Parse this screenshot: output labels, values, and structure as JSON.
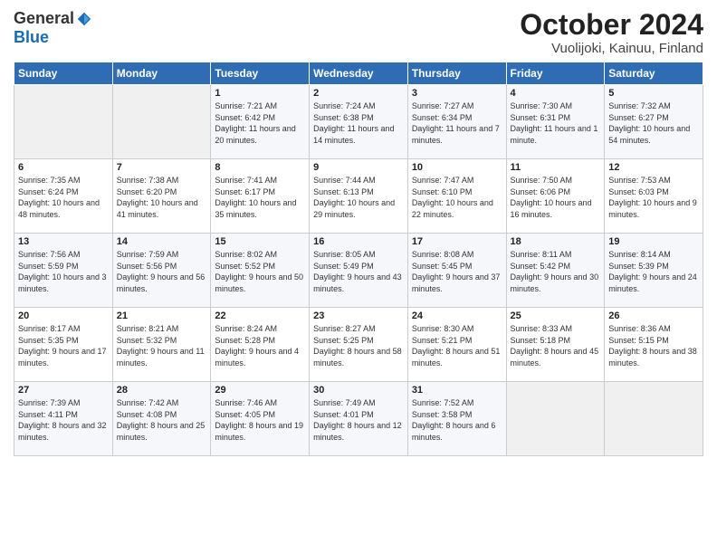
{
  "logo": {
    "general": "General",
    "blue": "Blue"
  },
  "header": {
    "month": "October 2024",
    "location": "Vuolijoki, Kainuu, Finland"
  },
  "days_of_week": [
    "Sunday",
    "Monday",
    "Tuesday",
    "Wednesday",
    "Thursday",
    "Friday",
    "Saturday"
  ],
  "weeks": [
    [
      {
        "day": "",
        "info": ""
      },
      {
        "day": "",
        "info": ""
      },
      {
        "day": "1",
        "info": "Sunrise: 7:21 AM\nSunset: 6:42 PM\nDaylight: 11 hours and 20 minutes."
      },
      {
        "day": "2",
        "info": "Sunrise: 7:24 AM\nSunset: 6:38 PM\nDaylight: 11 hours and 14 minutes."
      },
      {
        "day": "3",
        "info": "Sunrise: 7:27 AM\nSunset: 6:34 PM\nDaylight: 11 hours and 7 minutes."
      },
      {
        "day": "4",
        "info": "Sunrise: 7:30 AM\nSunset: 6:31 PM\nDaylight: 11 hours and 1 minute."
      },
      {
        "day": "5",
        "info": "Sunrise: 7:32 AM\nSunset: 6:27 PM\nDaylight: 10 hours and 54 minutes."
      }
    ],
    [
      {
        "day": "6",
        "info": "Sunrise: 7:35 AM\nSunset: 6:24 PM\nDaylight: 10 hours and 48 minutes."
      },
      {
        "day": "7",
        "info": "Sunrise: 7:38 AM\nSunset: 6:20 PM\nDaylight: 10 hours and 41 minutes."
      },
      {
        "day": "8",
        "info": "Sunrise: 7:41 AM\nSunset: 6:17 PM\nDaylight: 10 hours and 35 minutes."
      },
      {
        "day": "9",
        "info": "Sunrise: 7:44 AM\nSunset: 6:13 PM\nDaylight: 10 hours and 29 minutes."
      },
      {
        "day": "10",
        "info": "Sunrise: 7:47 AM\nSunset: 6:10 PM\nDaylight: 10 hours and 22 minutes."
      },
      {
        "day": "11",
        "info": "Sunrise: 7:50 AM\nSunset: 6:06 PM\nDaylight: 10 hours and 16 minutes."
      },
      {
        "day": "12",
        "info": "Sunrise: 7:53 AM\nSunset: 6:03 PM\nDaylight: 10 hours and 9 minutes."
      }
    ],
    [
      {
        "day": "13",
        "info": "Sunrise: 7:56 AM\nSunset: 5:59 PM\nDaylight: 10 hours and 3 minutes."
      },
      {
        "day": "14",
        "info": "Sunrise: 7:59 AM\nSunset: 5:56 PM\nDaylight: 9 hours and 56 minutes."
      },
      {
        "day": "15",
        "info": "Sunrise: 8:02 AM\nSunset: 5:52 PM\nDaylight: 9 hours and 50 minutes."
      },
      {
        "day": "16",
        "info": "Sunrise: 8:05 AM\nSunset: 5:49 PM\nDaylight: 9 hours and 43 minutes."
      },
      {
        "day": "17",
        "info": "Sunrise: 8:08 AM\nSunset: 5:45 PM\nDaylight: 9 hours and 37 minutes."
      },
      {
        "day": "18",
        "info": "Sunrise: 8:11 AM\nSunset: 5:42 PM\nDaylight: 9 hours and 30 minutes."
      },
      {
        "day": "19",
        "info": "Sunrise: 8:14 AM\nSunset: 5:39 PM\nDaylight: 9 hours and 24 minutes."
      }
    ],
    [
      {
        "day": "20",
        "info": "Sunrise: 8:17 AM\nSunset: 5:35 PM\nDaylight: 9 hours and 17 minutes."
      },
      {
        "day": "21",
        "info": "Sunrise: 8:21 AM\nSunset: 5:32 PM\nDaylight: 9 hours and 11 minutes."
      },
      {
        "day": "22",
        "info": "Sunrise: 8:24 AM\nSunset: 5:28 PM\nDaylight: 9 hours and 4 minutes."
      },
      {
        "day": "23",
        "info": "Sunrise: 8:27 AM\nSunset: 5:25 PM\nDaylight: 8 hours and 58 minutes."
      },
      {
        "day": "24",
        "info": "Sunrise: 8:30 AM\nSunset: 5:21 PM\nDaylight: 8 hours and 51 minutes."
      },
      {
        "day": "25",
        "info": "Sunrise: 8:33 AM\nSunset: 5:18 PM\nDaylight: 8 hours and 45 minutes."
      },
      {
        "day": "26",
        "info": "Sunrise: 8:36 AM\nSunset: 5:15 PM\nDaylight: 8 hours and 38 minutes."
      }
    ],
    [
      {
        "day": "27",
        "info": "Sunrise: 7:39 AM\nSunset: 4:11 PM\nDaylight: 8 hours and 32 minutes."
      },
      {
        "day": "28",
        "info": "Sunrise: 7:42 AM\nSunset: 4:08 PM\nDaylight: 8 hours and 25 minutes."
      },
      {
        "day": "29",
        "info": "Sunrise: 7:46 AM\nSunset: 4:05 PM\nDaylight: 8 hours and 19 minutes."
      },
      {
        "day": "30",
        "info": "Sunrise: 7:49 AM\nSunset: 4:01 PM\nDaylight: 8 hours and 12 minutes."
      },
      {
        "day": "31",
        "info": "Sunrise: 7:52 AM\nSunset: 3:58 PM\nDaylight: 8 hours and 6 minutes."
      },
      {
        "day": "",
        "info": ""
      },
      {
        "day": "",
        "info": ""
      }
    ]
  ]
}
